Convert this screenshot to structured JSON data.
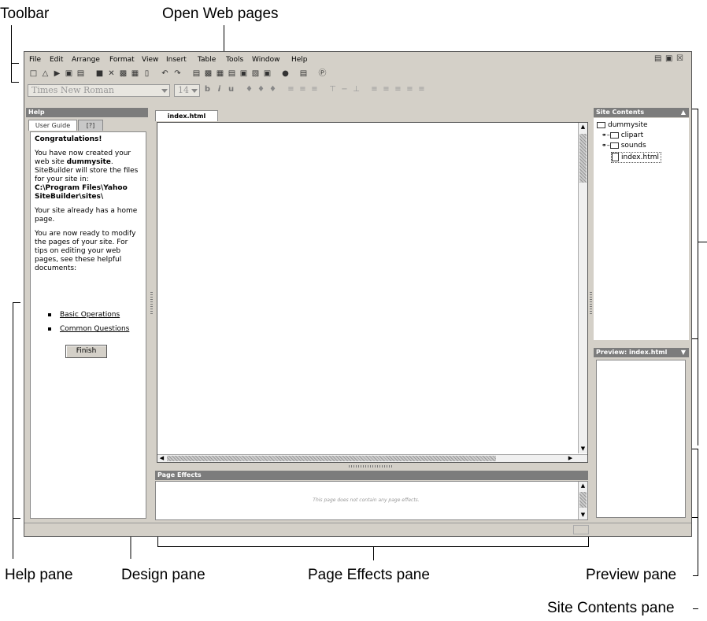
{
  "callouts": {
    "toolbar": "Toolbar",
    "open_web_pages": "Open Web pages",
    "help_pane": "Help pane",
    "design_pane": "Design pane",
    "page_effects_pane": "Page Effects pane",
    "preview_pane": "Preview pane",
    "site_contents_pane": "Site Contents pane"
  },
  "menu": {
    "file": "File",
    "edit": "Edit",
    "arrange": "Arrange",
    "format": "Format",
    "view": "View",
    "insert": "Insert",
    "table": "Table",
    "tools": "Tools",
    "window": "Window",
    "help": "Help"
  },
  "toolbar": {
    "font_name": "Times New Roman",
    "font_size": "14",
    "bold": "b",
    "italic": "i",
    "underline": "u"
  },
  "help_pane": {
    "title": "Help",
    "tab_user_guide": "User Guide",
    "tab_question": "[?]",
    "heading": "Congratulations!",
    "p1_pre": "You have now created your web site ",
    "p1_site": "dummysite",
    "p1_post": ". SiteBuilder will store the files for your site in:",
    "p1_path": "C:\\Program Files\\Yahoo SiteBuilder\\sites\\",
    "p2": "Your site already has a home page.",
    "p3": "You are now ready to modify the pages of your site. For tips on editing your web pages, see these helpful documents:",
    "link1": "Basic Operations",
    "link2": "Common Questions",
    "finish": "Finish"
  },
  "design_pane": {
    "tab": "index.html"
  },
  "page_effects": {
    "title": "Page Effects",
    "message": "This page does not contain any page effects."
  },
  "site_contents": {
    "title": "Site Contents",
    "root": "dummysite",
    "items": [
      "clipart",
      "sounds",
      "index.html"
    ]
  },
  "preview": {
    "title": "Preview: index.html"
  }
}
